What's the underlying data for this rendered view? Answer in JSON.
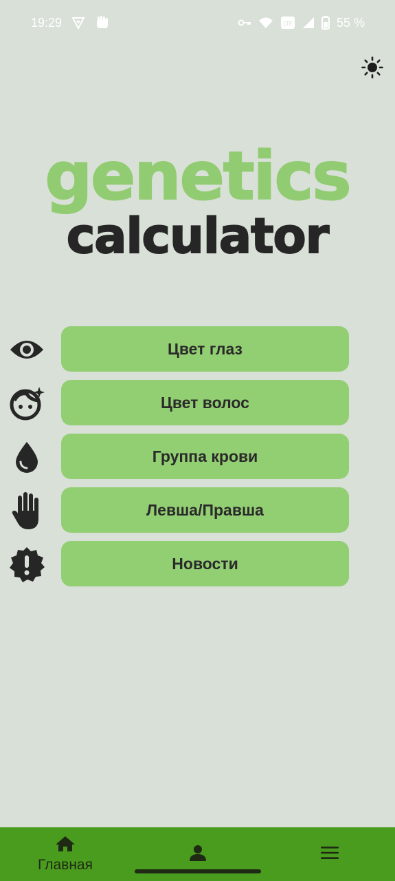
{
  "status_bar": {
    "time": "19:29",
    "battery": "55 %",
    "icons": [
      "vpn-shield-icon",
      "hand-fist-icon",
      "key-icon",
      "wifi-icon",
      "volte-icon",
      "signal-icon",
      "battery-icon"
    ]
  },
  "header": {
    "theme_toggle_icon": "sun-icon"
  },
  "logo": {
    "line1": "genetics",
    "line2": "calculator",
    "line1_color": "#92cc72",
    "line2_color": "#262626"
  },
  "menu": {
    "items": [
      {
        "label": "Цвет глаз",
        "icon": "eye-icon"
      },
      {
        "label": "Цвет волос",
        "icon": "face-sparkle-icon"
      },
      {
        "label": "Группа крови",
        "icon": "blood-drop-icon"
      },
      {
        "label": "Левша/Правша",
        "icon": "hand-icon"
      },
      {
        "label": "Новости",
        "icon": "alert-badge-icon"
      }
    ],
    "button_color": "#92ce72"
  },
  "bottom_nav": {
    "home_label": "Главная",
    "home_icon": "home-icon",
    "profile_icon": "person-icon",
    "menu_icon": "hamburger-icon",
    "background": "#4a9c1e"
  }
}
